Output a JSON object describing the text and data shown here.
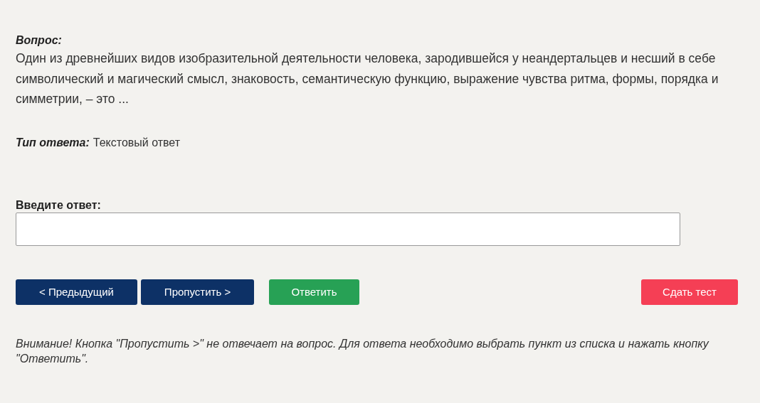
{
  "question": {
    "label": "Вопрос:",
    "text": "Один из древнейших видов изобразительной деятельности человека, зародившейся у неандертальцев и несший в себе символический и магический смысл, знаковость, семантическую функцию, выражение чувства ритма, формы, порядка и симметрии, – это ..."
  },
  "answer_type": {
    "label": "Тип ответа:",
    "value": "Текстовый ответ"
  },
  "answer_field": {
    "label": "Введите ответ:"
  },
  "buttons": [
    {
      "label": "< Предыдущий",
      "kind": "nav"
    },
    {
      "label": "Пропустить >",
      "kind": "nav"
    },
    {
      "label": "Ответить",
      "kind": "answer"
    },
    {
      "label": "Сдать тест",
      "kind": "finish"
    }
  ],
  "notice": "Внимание! Кнопка \"Пропустить >\" не отвечает на вопрос. Для ответа необходимо выбрать пункт из списка и нажать кнопку \"Ответить\"."
}
